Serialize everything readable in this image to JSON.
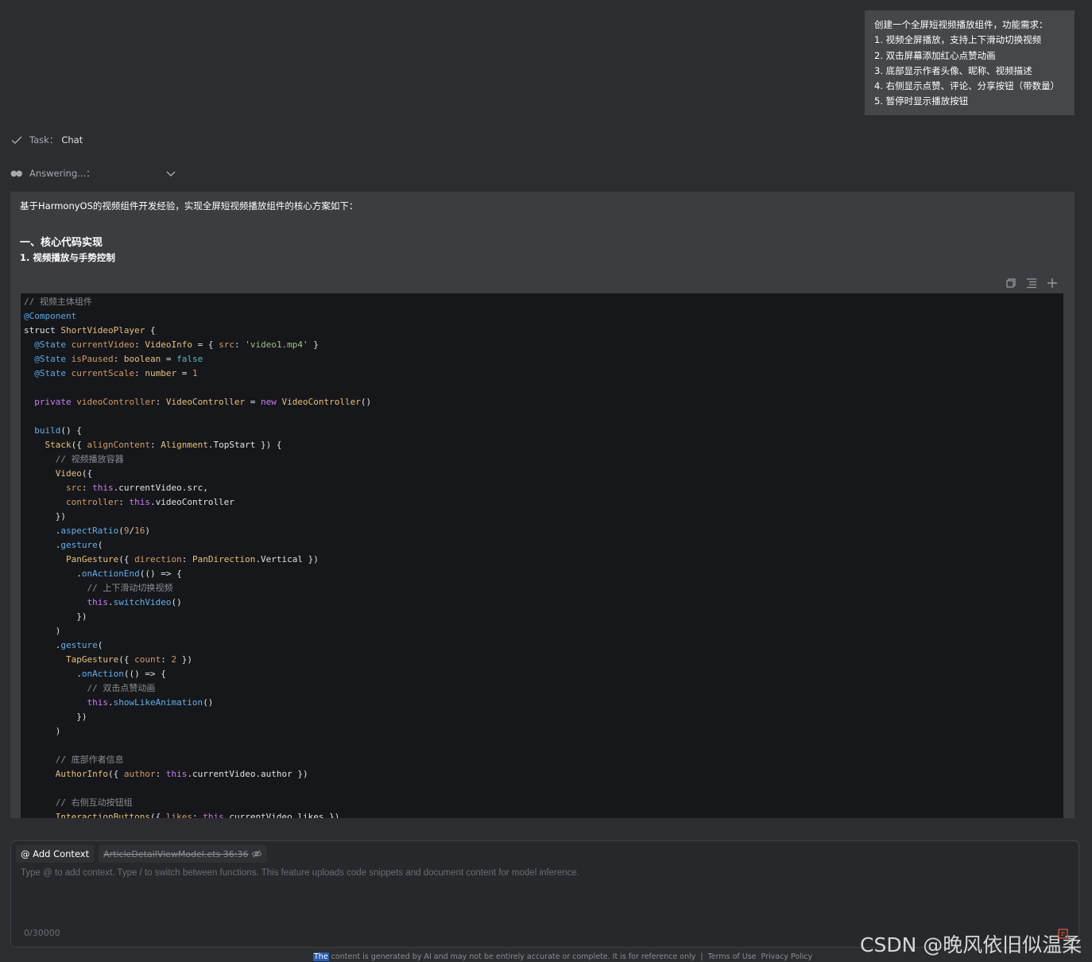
{
  "user_message": {
    "lines": [
      "创建一个全屏短视频播放组件，功能需求：",
      "1. 视频全屏播放，支持上下滑动切换视频",
      "2. 双击屏幕添加红心点赞动画",
      "3. 底部显示作者头像、昵称、视频描述",
      "4. 右侧显示点赞、评论、分享按钮（带数量）",
      "5. 暂停时显示播放按钮"
    ]
  },
  "task": {
    "label": "Task：",
    "value": "Chat"
  },
  "answering": {
    "label": "Answering...："
  },
  "answer": {
    "intro": "基于HarmonyOS的视频组件开发经验，实现全屏短视频播放组件的核心方案如下：",
    "heading1": "一、核心代码实现",
    "heading2": "1. 视频播放与手势控制",
    "code_lines": [
      [
        {
          "t": "// 视频主体组件",
          "c": "cmt"
        }
      ],
      [
        {
          "t": "@Component",
          "c": "dec"
        }
      ],
      [
        {
          "t": "struct ",
          "c": "plain"
        },
        {
          "t": "ShortVideoPlayer",
          "c": "type"
        },
        {
          "t": " {",
          "c": "plain"
        }
      ],
      [
        {
          "t": "  @State ",
          "c": "dec"
        },
        {
          "t": "currentVideo",
          "c": "prop"
        },
        {
          "t": ": ",
          "c": "plain"
        },
        {
          "t": "VideoInfo",
          "c": "type"
        },
        {
          "t": " = { ",
          "c": "plain"
        },
        {
          "t": "src",
          "c": "prop"
        },
        {
          "t": ": ",
          "c": "plain"
        },
        {
          "t": "'video1.mp4'",
          "c": "str"
        },
        {
          "t": " }",
          "c": "plain"
        }
      ],
      [
        {
          "t": "  @State ",
          "c": "dec"
        },
        {
          "t": "isPaused",
          "c": "prop"
        },
        {
          "t": ": ",
          "c": "plain"
        },
        {
          "t": "boolean",
          "c": "type"
        },
        {
          "t": " = ",
          "c": "plain"
        },
        {
          "t": "false",
          "c": "bool"
        }
      ],
      [
        {
          "t": "  @State ",
          "c": "dec"
        },
        {
          "t": "currentScale",
          "c": "prop"
        },
        {
          "t": ": ",
          "c": "plain"
        },
        {
          "t": "number",
          "c": "type"
        },
        {
          "t": " = ",
          "c": "plain"
        },
        {
          "t": "1",
          "c": "num"
        }
      ],
      [
        {
          "t": "",
          "c": "plain"
        }
      ],
      [
        {
          "t": "  private ",
          "c": "kw"
        },
        {
          "t": "videoController",
          "c": "prop"
        },
        {
          "t": ": ",
          "c": "plain"
        },
        {
          "t": "VideoController",
          "c": "type"
        },
        {
          "t": " = ",
          "c": "plain"
        },
        {
          "t": "new ",
          "c": "kw"
        },
        {
          "t": "VideoController",
          "c": "type"
        },
        {
          "t": "()",
          "c": "plain"
        }
      ],
      [
        {
          "t": "",
          "c": "plain"
        }
      ],
      [
        {
          "t": "  build",
          "c": "fn"
        },
        {
          "t": "() {",
          "c": "plain"
        }
      ],
      [
        {
          "t": "    Stack",
          "c": "type"
        },
        {
          "t": "({ ",
          "c": "plain"
        },
        {
          "t": "alignContent",
          "c": "prop"
        },
        {
          "t": ": ",
          "c": "plain"
        },
        {
          "t": "Alignment",
          "c": "type"
        },
        {
          "t": ".TopStart }) {",
          "c": "plain"
        }
      ],
      [
        {
          "t": "      // 视频播放容器",
          "c": "cmt"
        }
      ],
      [
        {
          "t": "      Video",
          "c": "type"
        },
        {
          "t": "({",
          "c": "plain"
        }
      ],
      [
        {
          "t": "        src",
          "c": "prop"
        },
        {
          "t": ": ",
          "c": "plain"
        },
        {
          "t": "this",
          "c": "kw"
        },
        {
          "t": ".currentVideo.src,",
          "c": "plain"
        }
      ],
      [
        {
          "t": "        controller",
          "c": "prop"
        },
        {
          "t": ": ",
          "c": "plain"
        },
        {
          "t": "this",
          "c": "kw"
        },
        {
          "t": ".videoController",
          "c": "plain"
        }
      ],
      [
        {
          "t": "      })",
          "c": "plain"
        }
      ],
      [
        {
          "t": "      .",
          "c": "plain"
        },
        {
          "t": "aspectRatio",
          "c": "fn"
        },
        {
          "t": "(",
          "c": "plain"
        },
        {
          "t": "9",
          "c": "num"
        },
        {
          "t": "/",
          "c": "plain"
        },
        {
          "t": "16",
          "c": "num"
        },
        {
          "t": ")",
          "c": "plain"
        }
      ],
      [
        {
          "t": "      .",
          "c": "plain"
        },
        {
          "t": "gesture",
          "c": "fn"
        },
        {
          "t": "(",
          "c": "plain"
        }
      ],
      [
        {
          "t": "        PanGesture",
          "c": "type"
        },
        {
          "t": "({ ",
          "c": "plain"
        },
        {
          "t": "direction",
          "c": "prop"
        },
        {
          "t": ": ",
          "c": "plain"
        },
        {
          "t": "PanDirection",
          "c": "type"
        },
        {
          "t": ".Vertical })",
          "c": "plain"
        }
      ],
      [
        {
          "t": "          .",
          "c": "plain"
        },
        {
          "t": "onActionEnd",
          "c": "fn"
        },
        {
          "t": "(() => {",
          "c": "plain"
        }
      ],
      [
        {
          "t": "            // 上下滑动切换视频",
          "c": "cmt"
        }
      ],
      [
        {
          "t": "            this",
          "c": "kw"
        },
        {
          "t": ".",
          "c": "plain"
        },
        {
          "t": "switchVideo",
          "c": "fn"
        },
        {
          "t": "()",
          "c": "plain"
        }
      ],
      [
        {
          "t": "          })",
          "c": "plain"
        }
      ],
      [
        {
          "t": "      )",
          "c": "plain"
        }
      ],
      [
        {
          "t": "      .",
          "c": "plain"
        },
        {
          "t": "gesture",
          "c": "fn"
        },
        {
          "t": "(",
          "c": "plain"
        }
      ],
      [
        {
          "t": "        TapGesture",
          "c": "type"
        },
        {
          "t": "({ ",
          "c": "plain"
        },
        {
          "t": "count",
          "c": "prop"
        },
        {
          "t": ": ",
          "c": "plain"
        },
        {
          "t": "2",
          "c": "num"
        },
        {
          "t": " })",
          "c": "plain"
        }
      ],
      [
        {
          "t": "          .",
          "c": "plain"
        },
        {
          "t": "onAction",
          "c": "fn"
        },
        {
          "t": "(() => {",
          "c": "plain"
        }
      ],
      [
        {
          "t": "            // 双击点赞动画",
          "c": "cmt"
        }
      ],
      [
        {
          "t": "            this",
          "c": "kw"
        },
        {
          "t": ".",
          "c": "plain"
        },
        {
          "t": "showLikeAnimation",
          "c": "fn"
        },
        {
          "t": "()",
          "c": "plain"
        }
      ],
      [
        {
          "t": "          })",
          "c": "plain"
        }
      ],
      [
        {
          "t": "      )",
          "c": "plain"
        }
      ],
      [
        {
          "t": "",
          "c": "plain"
        }
      ],
      [
        {
          "t": "      // 底部作者信息",
          "c": "cmt"
        }
      ],
      [
        {
          "t": "      AuthorInfo",
          "c": "type"
        },
        {
          "t": "({ ",
          "c": "plain"
        },
        {
          "t": "author",
          "c": "prop"
        },
        {
          "t": ": ",
          "c": "plain"
        },
        {
          "t": "this",
          "c": "kw"
        },
        {
          "t": ".currentVideo.author })",
          "c": "plain"
        }
      ],
      [
        {
          "t": "",
          "c": "plain"
        }
      ],
      [
        {
          "t": "      // 右侧互动按钮组",
          "c": "cmt"
        }
      ],
      [
        {
          "t": "      InteractionButtons",
          "c": "type"
        },
        {
          "t": "({ ",
          "c": "plain"
        },
        {
          "t": "likes",
          "c": "prop"
        },
        {
          "t": ": ",
          "c": "plain"
        },
        {
          "t": "this",
          "c": "kw"
        },
        {
          "t": ".currentVideo.likes })",
          "c": "plain"
        }
      ]
    ]
  },
  "input": {
    "add_context_label": "@ Add Context",
    "file_chip": "ArticleDetailViewModel.ets 36:36",
    "placeholder": "Type @ to add context. Type / to switch between functions. This feature uploads code snippets and document content for model inference.",
    "counter": "0/30000"
  },
  "footer": {
    "highlight": "The",
    "text": "content is generated by AI and may not be entirely accurate or complete. It is for reference only",
    "separator": "|",
    "terms": "Terms of Use",
    "privacy": "Privacy Policy"
  },
  "watermark": "CSDN @晚风依旧似温柔",
  "icons": {
    "check": "check-icon",
    "dots": "dots-icon",
    "chevron": "chevron-down-icon",
    "copy": "copy-icon",
    "list": "list-icon",
    "plus": "plus-icon",
    "eye_off": "eye-off-icon"
  }
}
